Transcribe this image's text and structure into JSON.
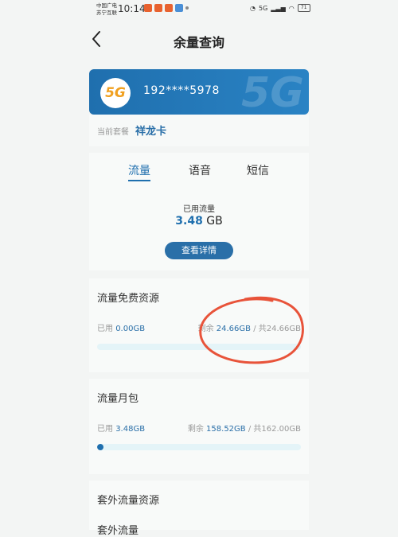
{
  "status_bar": {
    "carrier_line1": "中国广电",
    "carrier_line2": "苏宁互联",
    "time": "10:14",
    "signal": "5G",
    "battery": "71"
  },
  "header": {
    "title": "余量查询"
  },
  "sim": {
    "logo": "5G",
    "phone": "192****5978"
  },
  "plan": {
    "label": "当前套餐",
    "name": "祥龙卡"
  },
  "tabs": [
    {
      "label": "流量",
      "active": true
    },
    {
      "label": "语音",
      "active": false
    },
    {
      "label": "短信",
      "active": false
    }
  ],
  "usage": {
    "label": "已用流量",
    "value": "3.48",
    "unit": "GB",
    "detail_button": "查看详情"
  },
  "free_resource": {
    "title": "流量免费资源",
    "used_label": "已用",
    "used_value": "0.00GB",
    "remain_label": "剩余",
    "remain_value": "24.66GB",
    "total_sep": " / 共",
    "total_value": "24.66GB",
    "used_fraction": 0.0
  },
  "monthly_pack": {
    "title": "流量月包",
    "used_label": "已用",
    "used_value": "3.48GB",
    "remain_label": "剩余",
    "remain_value": "158.52GB",
    "total_sep": " / 共",
    "total_value": "162.00GB",
    "used_fraction": 0.021
  },
  "extra": {
    "title": "套外流量资源",
    "subtitle": "套外流量"
  },
  "colors": {
    "accent": "#1f6fae",
    "annotation": "#e8533a"
  }
}
